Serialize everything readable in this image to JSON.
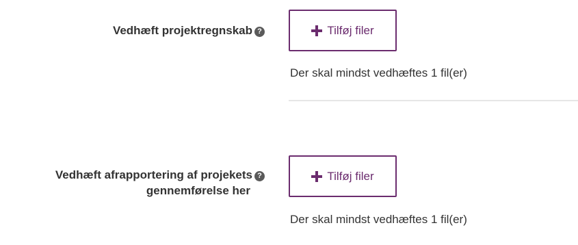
{
  "field1": {
    "label": "Vedhæft projektregnskab",
    "help_icon": "question-circle-icon",
    "button_icon": "plus-icon",
    "button_label": "Tilføj filer",
    "help_text": "Der skal mindst vedhæftes 1 fil(er)"
  },
  "field2": {
    "label_line1": "Vedhæft afrapportering af projekets",
    "label_line2": "gennemførelse her",
    "help_icon": "question-circle-icon",
    "button_icon": "plus-icon",
    "button_label": "Tilføj filer",
    "help_text": "Der skal mindst vedhæftes 1 fil(er)"
  },
  "colors": {
    "accent": "#6b2c6e",
    "text": "#333333",
    "divider": "#e6e6e6"
  }
}
